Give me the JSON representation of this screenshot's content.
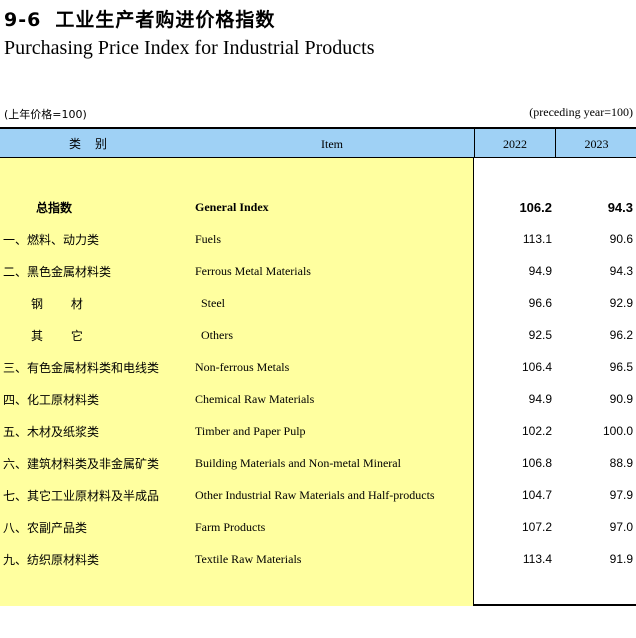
{
  "title": {
    "number": "9-6",
    "cn": "工业生产者购进价格指数",
    "en": "Purchasing Price Index for Industrial Products"
  },
  "unit": {
    "cn": "(上年价格=100)",
    "en": "(preceding year=100)"
  },
  "header": {
    "category": "类别",
    "item": "Item",
    "year1": "2022",
    "year2": "2023"
  },
  "rows": [
    {
      "cn": "总指数",
      "en": "General Index",
      "v2022": "106.2",
      "v2023": "94.3"
    },
    {
      "cn": "一、燃料、动力类",
      "en": "Fuels",
      "v2022": "113.1",
      "v2023": "90.6"
    },
    {
      "cn": "二、黑色金属材料类",
      "en": "Ferrous Metal Materials",
      "v2022": "94.9",
      "v2023": "94.3"
    },
    {
      "cn": "钢 材",
      "en": "Steel",
      "v2022": "96.6",
      "v2023": "92.9"
    },
    {
      "cn": "其 它",
      "en": "Others",
      "v2022": "92.5",
      "v2023": "96.2"
    },
    {
      "cn": "三、有色金属材料类和电线类",
      "en": "Non-ferrous Metals",
      "v2022": "106.4",
      "v2023": "96.5"
    },
    {
      "cn": "四、化工原材料类",
      "en": "Chemical Raw Materials",
      "v2022": "94.9",
      "v2023": "90.9"
    },
    {
      "cn": "五、木材及纸浆类",
      "en": "Timber and Paper Pulp",
      "v2022": "102.2",
      "v2023": "100.0"
    },
    {
      "cn": "六、建筑材料类及非金属矿类",
      "en": "Building Materials and Non-metal Mineral",
      "v2022": "106.8",
      "v2023": "88.9"
    },
    {
      "cn": "七、其它工业原材料及半成品",
      "en": "Other Industrial Raw Materials and Half-products",
      "v2022": "104.7",
      "v2023": "97.9"
    },
    {
      "cn": "八、农副产品类",
      "en": "Farm Products",
      "v2022": "107.2",
      "v2023": "97.0"
    },
    {
      "cn": "九、纺织原材料类",
      "en": "Textile Raw Materials",
      "v2022": "113.4",
      "v2023": "91.9"
    }
  ]
}
